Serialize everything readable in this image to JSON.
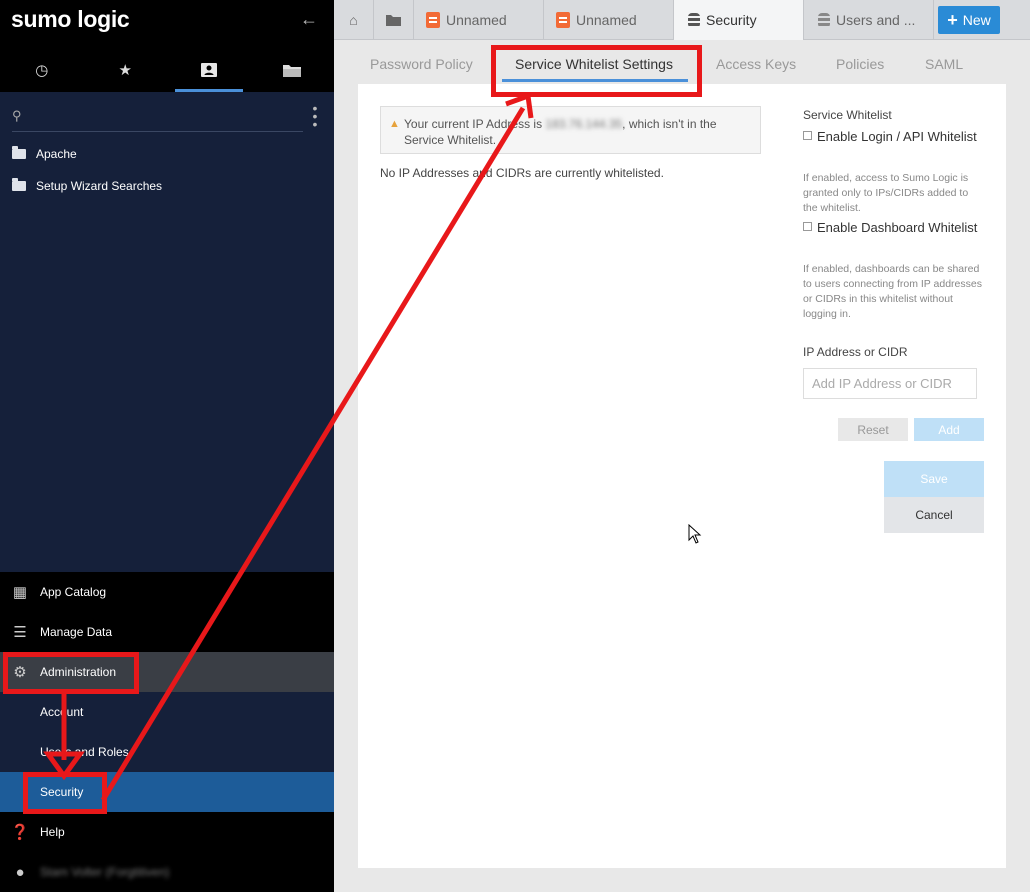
{
  "brand": "sumo logic",
  "sidebar": {
    "search_placeholder": "",
    "tree": [
      "Apache",
      "Setup Wizard Searches"
    ],
    "nav": {
      "app_catalog": "App Catalog",
      "manage_data": "Manage Data",
      "administration": "Administration",
      "account": "Account",
      "users_roles": "Users and Roles",
      "security": "Security",
      "help": "Help",
      "user_name": "Stam Volter (Forgtitiven)"
    }
  },
  "tabs": {
    "unnamed1": "Unnamed",
    "unnamed2": "Unnamed",
    "security": "Security",
    "users": "Users and ...",
    "new": "New"
  },
  "subtabs": [
    "Password Policy",
    "Service Whitelist Settings",
    "Access Keys",
    "Policies",
    "SAML"
  ],
  "warning": {
    "prefix": "Your current IP Address is ",
    "ip": "183.76.144.35",
    "suffix": ", which isn't in the Service Whitelist."
  },
  "no_ip_text": "No IP Addresses and CIDRs are currently whitelisted.",
  "settings": {
    "heading": "Service Whitelist",
    "login_label": "Enable Login / API Whitelist",
    "login_help": "If enabled, access to Sumo Logic is granted only to IPs/CIDRs added to the whitelist.",
    "dashboard_label": "Enable Dashboard Whitelist",
    "dashboard_help": "If enabled, dashboards can be shared to users connecting from IP addresses or CIDRs in this whitelist without logging in.",
    "ip_label": "IP Address or CIDR",
    "ip_placeholder": "Add IP Address or CIDR",
    "reset": "Reset",
    "add": "Add",
    "save": "Save",
    "cancel": "Cancel"
  },
  "colors": {
    "highlight": "#e8181a",
    "accent": "#4a90d9",
    "sidebar_bg": "#15203a",
    "active_nav": "#1d5c99"
  }
}
